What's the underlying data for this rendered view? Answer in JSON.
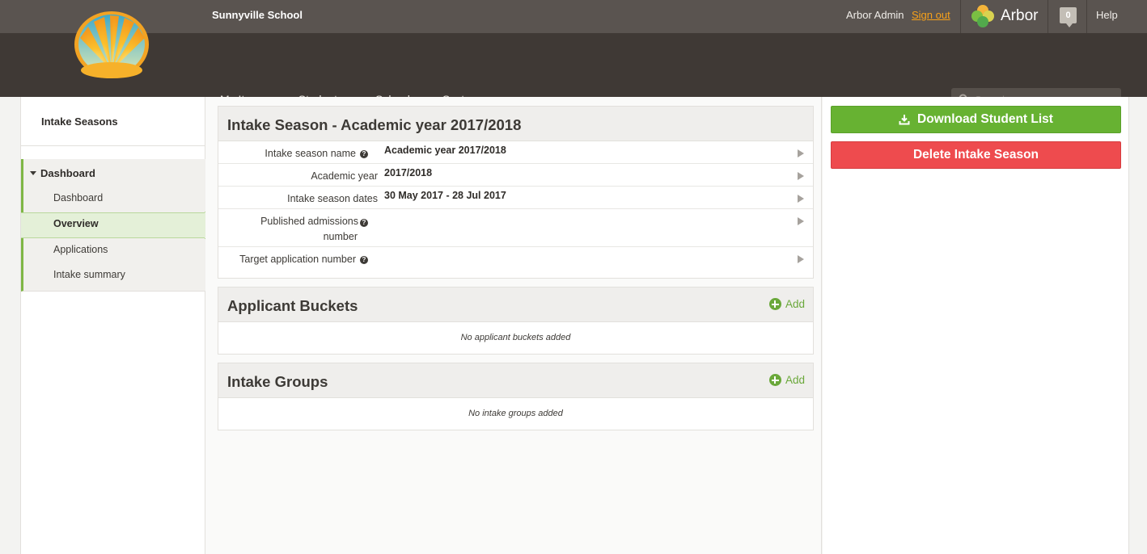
{
  "header": {
    "school_name": "Sunnyville School",
    "user_name": "Arbor Admin",
    "sign_out": "Sign out",
    "brand": "Arbor",
    "notification_count": "0",
    "help": "Help",
    "search_placeholder": "Search..."
  },
  "menu": [
    {
      "label": "My Items"
    },
    {
      "label": "Students"
    },
    {
      "label": "School"
    },
    {
      "label": "System"
    }
  ],
  "sidebar": {
    "title": "Intake Seasons",
    "group": "Dashboard",
    "items": [
      {
        "label": "Dashboard"
      },
      {
        "label": "Overview"
      },
      {
        "label": "Applications"
      },
      {
        "label": "Intake summary"
      }
    ]
  },
  "intake_panel": {
    "title": "Intake Season - Academic year 2017/2018",
    "rows": [
      {
        "label": "Intake season name",
        "value": "Academic year 2017/2018"
      },
      {
        "label": "Academic year",
        "value": "2017/2018"
      },
      {
        "label": "Intake season dates",
        "value": "30 May 2017 - 28 Jul 2017"
      },
      {
        "label_line1": "Published admissions",
        "label_line2": "number",
        "value": ""
      },
      {
        "label": "Target application number",
        "value": ""
      }
    ]
  },
  "buckets_panel": {
    "title": "Applicant Buckets",
    "add_label": "Add",
    "empty": "No applicant buckets added"
  },
  "groups_panel": {
    "title": "Intake Groups",
    "add_label": "Add",
    "empty": "No intake groups added"
  },
  "actions": {
    "download": "Download Student List",
    "delete": "Delete Intake Season"
  },
  "colors": {
    "accent_orange": "#f7a11a",
    "accent_green": "#67b232",
    "danger_red": "#ee4b4e"
  }
}
